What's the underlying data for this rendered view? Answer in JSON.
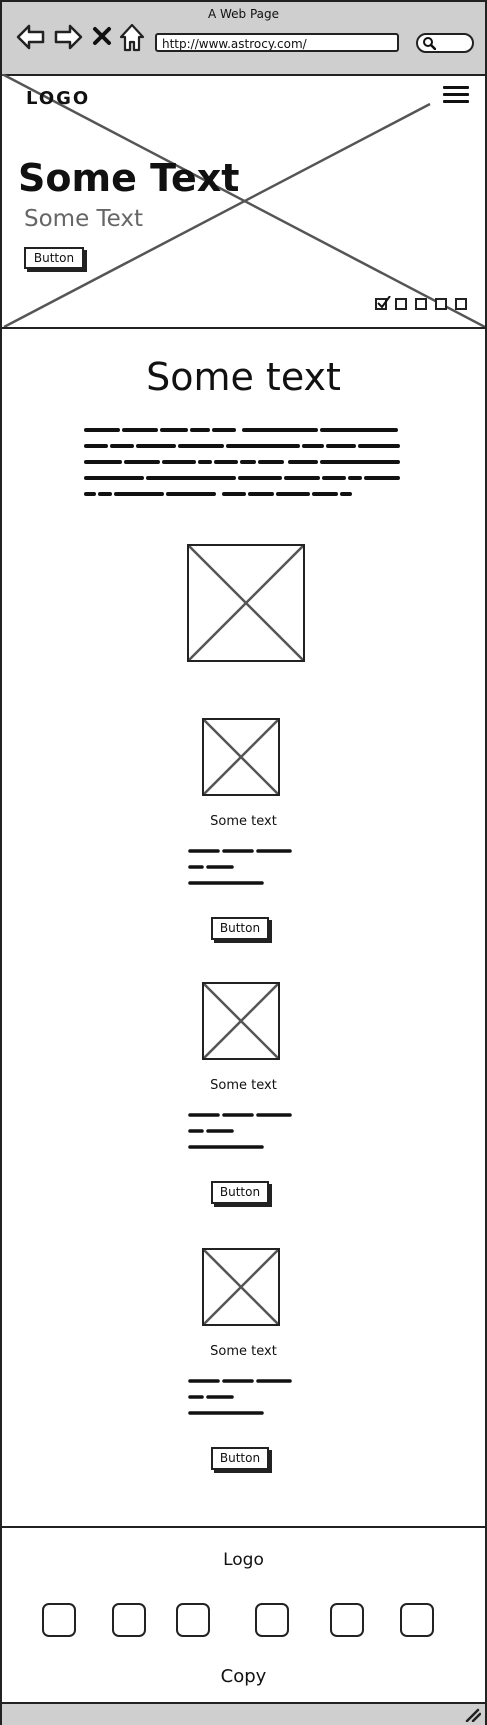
{
  "browser": {
    "title": "A Web Page",
    "url": "http://www.astrocy.com/",
    "icons": [
      "back-arrow-icon",
      "forward-arrow-icon",
      "close-icon",
      "home-icon",
      "search-icon"
    ]
  },
  "hero": {
    "logo": "LOGO",
    "title": "Some Text",
    "subtitle": "Some Text",
    "button_label": "Button",
    "slides": [
      true,
      false,
      false,
      false,
      false
    ]
  },
  "main": {
    "title": "Some text",
    "cards": [
      {
        "title": "Some text",
        "button_label": "Button"
      },
      {
        "title": "Some text",
        "button_label": "Button"
      },
      {
        "title": "Some text",
        "button_label": "Button"
      }
    ]
  },
  "footer": {
    "logo": "Logo",
    "copy": "Copy",
    "social_count": 6
  }
}
